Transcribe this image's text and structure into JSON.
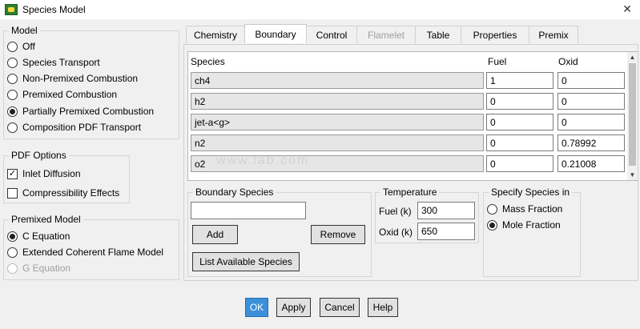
{
  "window": {
    "title": "Species Model",
    "close_glyph": "✕"
  },
  "model": {
    "title": "Model",
    "options": [
      {
        "label": "Off",
        "selected": false
      },
      {
        "label": "Species Transport",
        "selected": false
      },
      {
        "label": "Non-Premixed Combustion",
        "selected": false
      },
      {
        "label": "Premixed Combustion",
        "selected": false
      },
      {
        "label": "Partially Premixed Combustion",
        "selected": true
      },
      {
        "label": "Composition PDF Transport",
        "selected": false
      }
    ]
  },
  "pdf_options": {
    "title": "PDF Options",
    "items": [
      {
        "label": "Inlet Diffusion",
        "checked": true
      },
      {
        "label": "Compressibility Effects",
        "checked": false
      }
    ]
  },
  "premixed_model": {
    "title": "Premixed Model",
    "options": [
      {
        "label": "C Equation",
        "selected": true,
        "disabled": false
      },
      {
        "label": "Extended Coherent Flame Model",
        "selected": false,
        "disabled": false
      },
      {
        "label": "G Equation",
        "selected": false,
        "disabled": true
      }
    ]
  },
  "tabs": [
    {
      "label": "Chemistry",
      "active": false,
      "disabled": false
    },
    {
      "label": "Boundary",
      "active": true,
      "disabled": false
    },
    {
      "label": "Control",
      "active": false,
      "disabled": false
    },
    {
      "label": "Flamelet",
      "active": false,
      "disabled": true
    },
    {
      "label": "Table",
      "active": false,
      "disabled": false
    },
    {
      "label": "Properties",
      "active": false,
      "disabled": false
    },
    {
      "label": "Premix",
      "active": false,
      "disabled": false
    }
  ],
  "species_table": {
    "headers": {
      "species": "Species",
      "fuel": "Fuel",
      "oxid": "Oxid"
    },
    "rows": [
      {
        "species": "ch4",
        "fuel": "1",
        "oxid": "0"
      },
      {
        "species": "h2",
        "fuel": "0",
        "oxid": "0"
      },
      {
        "species": "jet-a<g>",
        "fuel": "0",
        "oxid": "0"
      },
      {
        "species": "n2",
        "fuel": "0",
        "oxid": "0.78992"
      },
      {
        "species": "o2",
        "fuel": "0",
        "oxid": "0.21008"
      }
    ]
  },
  "boundary_species": {
    "title": "Boundary Species",
    "input_value": "",
    "add_label": "Add",
    "remove_label": "Remove",
    "list_label": "List Available Species"
  },
  "temperature": {
    "title": "Temperature",
    "fuel_label": "Fuel (k)",
    "fuel_value": "300",
    "oxid_label": "Oxid (k)",
    "oxid_value": "650"
  },
  "specify_species": {
    "title": "Specify Species in",
    "options": [
      {
        "label": "Mass Fraction",
        "selected": false
      },
      {
        "label": "Mole Fraction",
        "selected": true
      }
    ]
  },
  "footer": {
    "ok": "OK",
    "apply": "Apply",
    "cancel": "Cancel",
    "help": "Help"
  },
  "watermark": "www.lab.com",
  "colors": {
    "primary_button": "#3c8fd8",
    "background": "#f0f0f0"
  }
}
